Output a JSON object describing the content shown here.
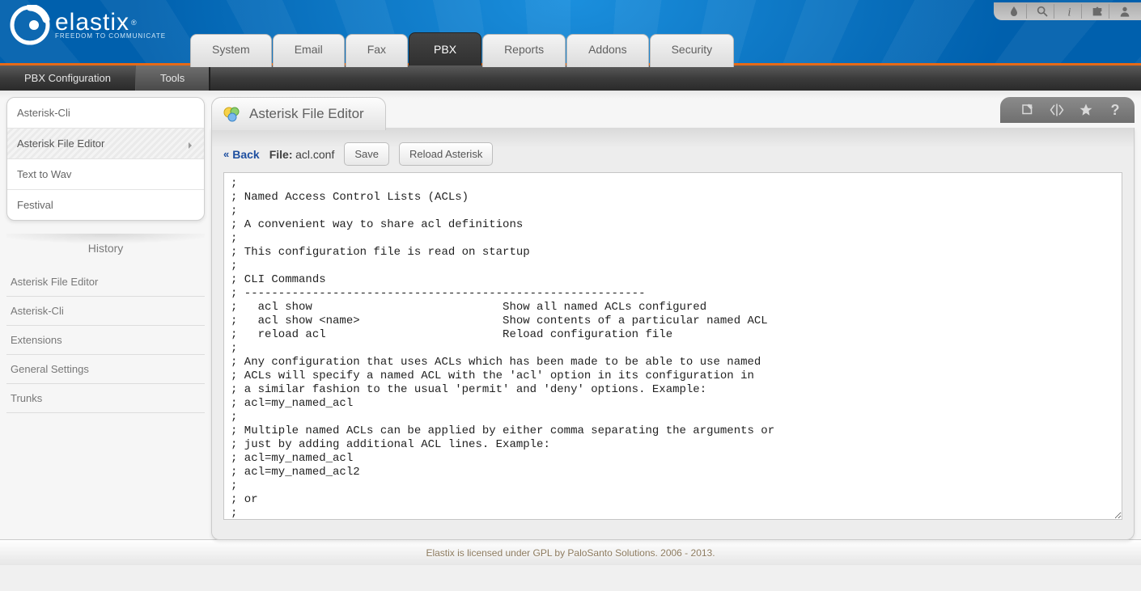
{
  "brand": {
    "name": "elastix",
    "tag": "FREEDOM TO COMMUNICATE",
    "reg": "®"
  },
  "topIcons": [
    "drop-icon",
    "search-icon",
    "info-icon",
    "puzzle-icon",
    "user-icon"
  ],
  "mainTabs": [
    {
      "label": "System",
      "active": false
    },
    {
      "label": "Email",
      "active": false
    },
    {
      "label": "Fax",
      "active": false
    },
    {
      "label": "PBX",
      "active": true
    },
    {
      "label": "Reports",
      "active": false
    },
    {
      "label": "Addons",
      "active": false
    },
    {
      "label": "Security",
      "active": false
    }
  ],
  "subTabs": [
    {
      "label": "PBX Configuration",
      "active": false
    },
    {
      "label": "Tools",
      "active": true
    }
  ],
  "toolsMenu": [
    {
      "label": "Asterisk-Cli",
      "active": false
    },
    {
      "label": "Asterisk File Editor",
      "active": true
    },
    {
      "label": "Text to Wav",
      "active": false
    },
    {
      "label": "Festival",
      "active": false
    }
  ],
  "history": {
    "title": "History",
    "items": [
      "Asterisk File Editor",
      "Asterisk-Cli",
      "Extensions",
      "General Settings",
      "Trunks"
    ]
  },
  "module": {
    "title": "Asterisk File Editor",
    "back": "Back",
    "fileLabel": "File:",
    "fileName": "acl.conf",
    "saveBtn": "Save",
    "reloadBtn": "Reload Asterisk"
  },
  "actionIcons": [
    "edit-icon",
    "inout-icon",
    "star-icon",
    "help-icon"
  ],
  "editorContent": ";\n; Named Access Control Lists (ACLs)\n;\n; A convenient way to share acl definitions\n;\n; This configuration file is read on startup\n;\n; CLI Commands\n; -----------------------------------------------------------\n;   acl show                            Show all named ACLs configured\n;   acl show <name>                     Show contents of a particular named ACL\n;   reload acl                          Reload configuration file\n;\n; Any configuration that uses ACLs which has been made to be able to use named\n; ACLs will specify a named ACL with the 'acl' option in its configuration in\n; a similar fashion to the usual 'permit' and 'deny' options. Example:\n; acl=my_named_acl\n;\n; Multiple named ACLs can be applied by either comma separating the arguments or\n; just by adding additional ACL lines. Example:\n; acl=my_named_acl\n; acl=my_named_acl2\n;\n; or\n;",
  "footer": "Elastix is licensed under GPL by PaloSanto Solutions. 2006 - 2013."
}
